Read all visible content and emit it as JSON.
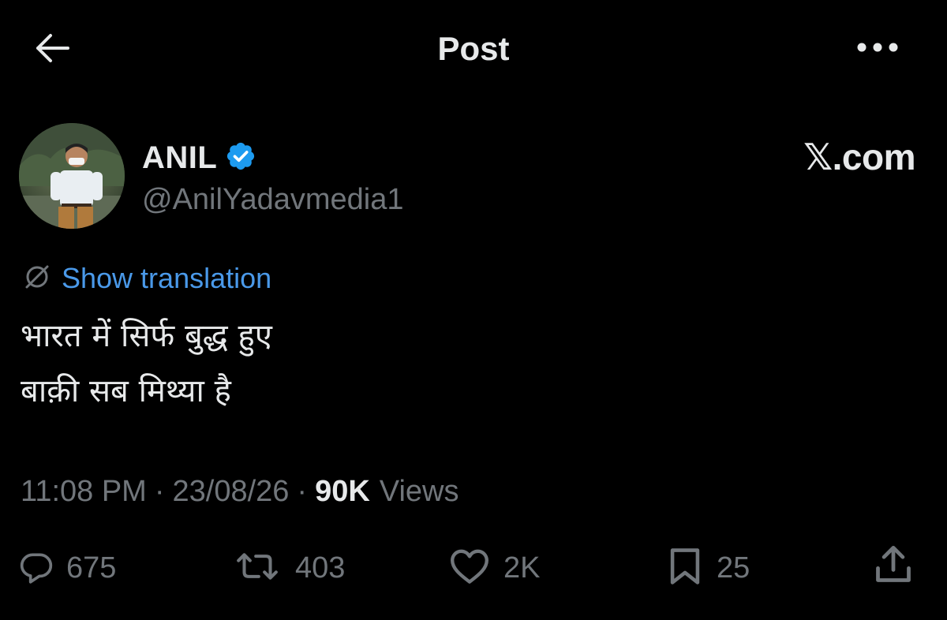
{
  "header": {
    "title": "Post"
  },
  "icons": {
    "back": "arrow-left-icon",
    "more": "more-horizontal-icon",
    "verified": "verified-badge-icon",
    "translate": "translate-globe-icon",
    "reply": "reply-bubble-icon",
    "repost": "repost-icon",
    "like": "heart-icon",
    "bookmark": "bookmark-icon",
    "share": "share-icon"
  },
  "author": {
    "name": "ANIL",
    "handle": "@AnilYadavmedia1",
    "verified": true
  },
  "watermark": "𝕏.com",
  "translation": {
    "label": "Show translation"
  },
  "post": {
    "lines": [
      "भारत में सिर्फ बुद्ध हुए",
      "बाक़ी सब मिथ्या है"
    ]
  },
  "meta": {
    "time": "11:08 PM",
    "separator": "·",
    "date": "23/08/26",
    "views_count": "90K",
    "views_label": "Views"
  },
  "actions": {
    "replies": "675",
    "reposts": "403",
    "likes": "2K",
    "bookmarks": "25"
  },
  "colors": {
    "background": "#000000",
    "text_primary": "#e7e9ea",
    "text_secondary": "#71767b",
    "link": "#4a99e9",
    "verified_badge": "#1d9bf0"
  }
}
